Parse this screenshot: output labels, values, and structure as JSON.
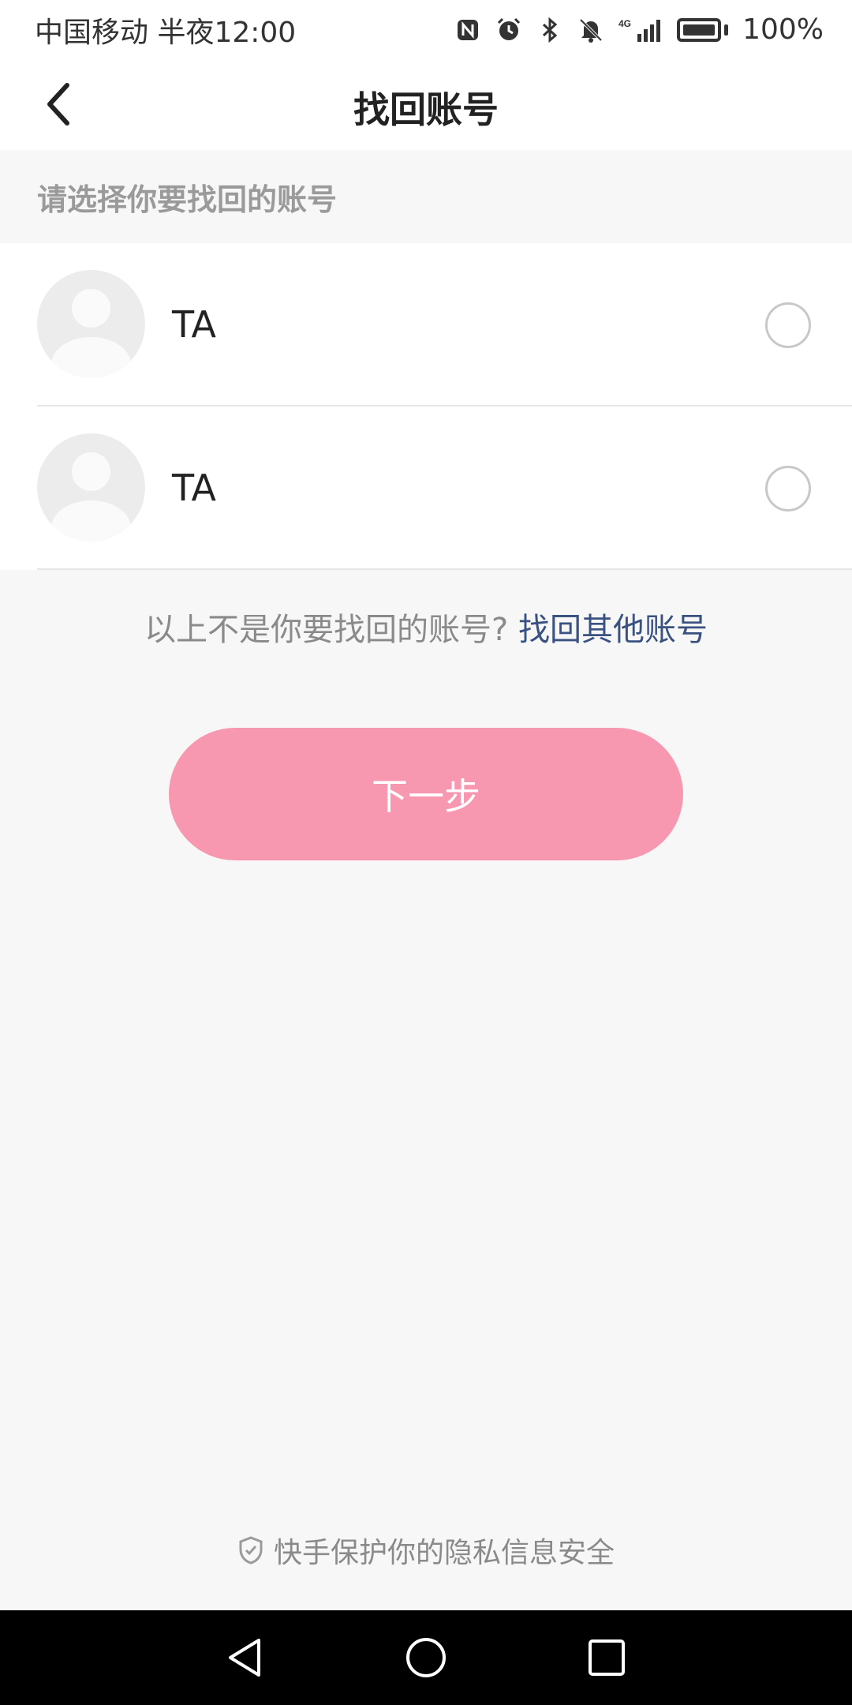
{
  "status_bar": {
    "carrier_time": "中国移动 半夜12:00",
    "network": "4G",
    "battery": "100%",
    "icons": [
      "nfc-icon",
      "alarm-icon",
      "bluetooth-icon",
      "mute-icon",
      "signal-icon",
      "battery-icon"
    ]
  },
  "header": {
    "title": "找回账号",
    "back_icon": "back-icon"
  },
  "section": {
    "label": "请选择你要找回的账号"
  },
  "accounts": [
    {
      "name": "TA",
      "selected": false
    },
    {
      "name": "TA",
      "selected": false
    }
  ],
  "other": {
    "question": "以上不是你要找回的账号?",
    "link": "找回其他账号"
  },
  "next_button": {
    "label": "下一步",
    "color": "#f898b0"
  },
  "footer": {
    "privacy_text": "快手保护你的隐私信息安全"
  },
  "colors": {
    "link": "#3a5281",
    "background": "#f7f7f7"
  }
}
